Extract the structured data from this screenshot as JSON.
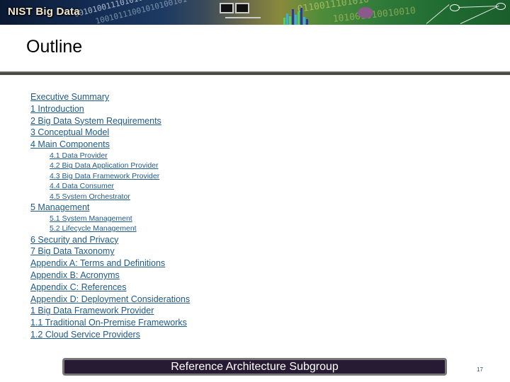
{
  "banner": {
    "title": "NIST Big Data",
    "binary_rows": [
      "001010011101010101010",
      "10010111001010100101",
      "0110011101010",
      "101001010010010"
    ]
  },
  "slide": {
    "title": "Outline"
  },
  "outline": {
    "items": [
      {
        "label": "Executive Summary",
        "level": 1
      },
      {
        "label": "1 Introduction",
        "level": 1
      },
      {
        "label": "2 Big Data System Requirements",
        "level": 1
      },
      {
        "label": "3 Conceptual Model",
        "level": 1
      },
      {
        "label": "4 Main Components",
        "level": 1
      },
      {
        "label": "4.1 Data Provider",
        "level": 2
      },
      {
        "label": "4.2 Big Data Application Provider",
        "level": 2
      },
      {
        "label": "4.3 Big Data Framework Provider",
        "level": 2
      },
      {
        "label": "4.4 Data Consumer",
        "level": 2
      },
      {
        "label": "4.5 System Orchestrator",
        "level": 2
      },
      {
        "label": "5 Management",
        "level": 1
      },
      {
        "label": "5.1 System Management",
        "level": 2
      },
      {
        "label": "5.2 Lifecycle Management",
        "level": 2
      },
      {
        "label": "6 Security and Privacy",
        "level": 1
      },
      {
        "label": "7 Big Data Taxonomy",
        "level": 1
      },
      {
        "label": "Appendix A: Terms and Definitions",
        "level": 1
      },
      {
        "label": "Appendix B: Acronyms",
        "level": 1
      },
      {
        "label": "Appendix C: References",
        "level": 1
      },
      {
        "label": "Appendix D: Deployment Considerations",
        "level": 1
      },
      {
        "label": "1 Big Data Framework Provider",
        "level": 1
      },
      {
        "label": "1.1 Traditional On-Premise Frameworks",
        "level": 1
      },
      {
        "label": "1.2 Cloud Service Providers",
        "level": 1
      }
    ]
  },
  "footer": {
    "label": "Reference Architecture Subgroup",
    "page_number": "17"
  },
  "colors": {
    "link": "#1f5a8a",
    "footer_bg": "#271a33",
    "footer_border": "#777777",
    "rule": "#6b6b66"
  }
}
